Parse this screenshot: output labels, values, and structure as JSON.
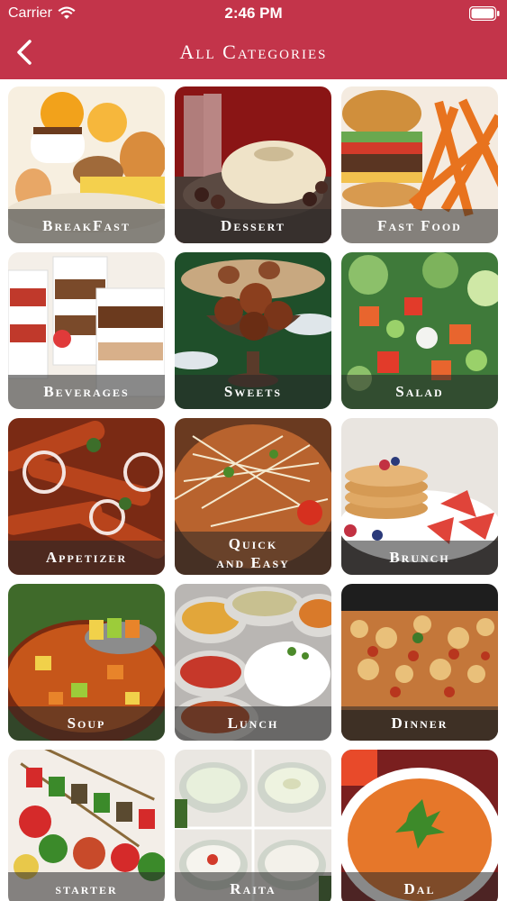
{
  "status_bar": {
    "carrier": "Carrier",
    "time": "2:46 PM"
  },
  "header": {
    "title": "All Categories",
    "back_icon": "chevron-left-icon"
  },
  "categories": [
    {
      "label": "BreakFast",
      "id": "breakfast"
    },
    {
      "label": "Dessert",
      "id": "dessert"
    },
    {
      "label": "Fast Food",
      "id": "fast-food"
    },
    {
      "label": "Beverages",
      "id": "beverages"
    },
    {
      "label": "Sweets",
      "id": "sweets"
    },
    {
      "label": "Salad",
      "id": "salad"
    },
    {
      "label": "Appetizer",
      "id": "appetizer"
    },
    {
      "label": "Quick\nand Easy",
      "id": "quick-and-easy"
    },
    {
      "label": "Brunch",
      "id": "brunch"
    },
    {
      "label": "Soup",
      "id": "soup"
    },
    {
      "label": "Lunch",
      "id": "lunch"
    },
    {
      "label": "Dinner",
      "id": "dinner"
    },
    {
      "label": "starter",
      "id": "starter"
    },
    {
      "label": "Raita",
      "id": "raita"
    },
    {
      "label": "Dal",
      "id": "dal"
    }
  ],
  "colors": {
    "header": "#c3344a",
    "label_overlay": "rgba(40,40,40,0.55)"
  }
}
